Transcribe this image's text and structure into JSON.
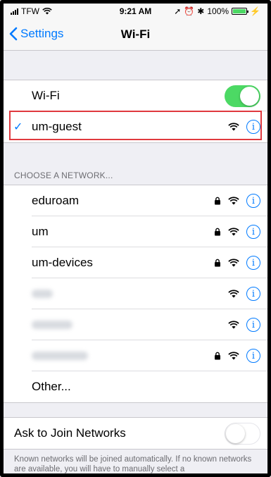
{
  "status_bar": {
    "carrier": "TFW",
    "time": "9:21 AM",
    "battery": "100%"
  },
  "nav": {
    "back_label": "Settings",
    "title": "Wi-Fi"
  },
  "wifi_toggle": {
    "label": "Wi-Fi",
    "state": "on"
  },
  "connected_network": {
    "name": "um-guest",
    "check_icon": "checkmark-icon"
  },
  "choose_header": "CHOOSE A NETWORK...",
  "networks": [
    {
      "name": "eduroam",
      "locked": true
    },
    {
      "name": "um",
      "locked": true
    },
    {
      "name": "um-devices",
      "locked": true
    },
    {
      "name": "",
      "locked": false
    },
    {
      "name": "",
      "locked": false
    },
    {
      "name": "",
      "locked": true
    }
  ],
  "other_label": "Other...",
  "ask_to_join": {
    "label": "Ask to Join Networks",
    "state": "off"
  },
  "footer": "Known networks will be joined automatically. If no known networks are available, you will have to manually select a",
  "colors": {
    "accent": "#007aff",
    "toggle_on": "#4cd964",
    "highlight": "#e0393e"
  }
}
